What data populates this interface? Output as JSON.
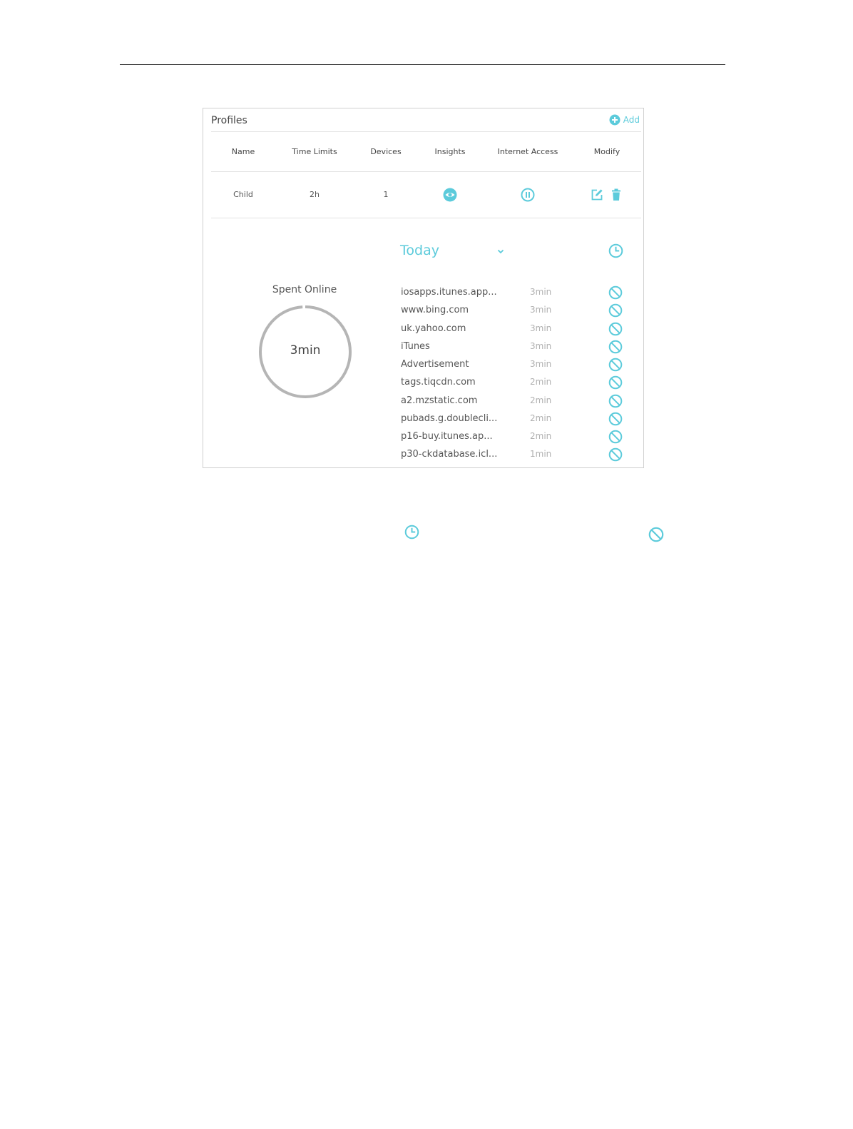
{
  "panel": {
    "title": "Profiles",
    "add_label": "Add"
  },
  "table": {
    "headers": [
      "Name",
      "Time Limits",
      "Devices",
      "Insights",
      "Internet Access",
      "Modify"
    ],
    "row": {
      "name": "Child",
      "time_limit": "2h",
      "devices": "1"
    }
  },
  "insights": {
    "range_selected": "Today",
    "spent_label": "Spent Online",
    "spent_value": "3min",
    "spent_fraction": 0.99,
    "sites": [
      {
        "name": "iosapps.itunes.app...",
        "time": "3min"
      },
      {
        "name": "www.bing.com",
        "time": "3min"
      },
      {
        "name": "uk.yahoo.com",
        "time": "3min"
      },
      {
        "name": "iTunes",
        "time": "3min"
      },
      {
        "name": "Advertisement",
        "time": "3min"
      },
      {
        "name": "tags.tiqcdn.com",
        "time": "2min"
      },
      {
        "name": "a2.mzstatic.com",
        "time": "2min"
      },
      {
        "name": "pubads.g.doublecli...",
        "time": "2min"
      },
      {
        "name": "p16-buy.itunes.ap...",
        "time": "2min"
      },
      {
        "name": "p30-ckdatabase.icl...",
        "time": "1min"
      }
    ]
  },
  "colors": {
    "accent": "#5ccbdb",
    "ring": "#b5b5b5",
    "text": "#555555",
    "muted": "#b0b0b0"
  },
  "icons": {
    "add": "plus-circle-icon",
    "insights": "eye-icon",
    "internet_access": "pause-circle-icon",
    "edit": "edit-icon",
    "delete": "trash-icon",
    "range": "chevron-down-icon",
    "history": "clock-icon",
    "block": "block-icon"
  }
}
